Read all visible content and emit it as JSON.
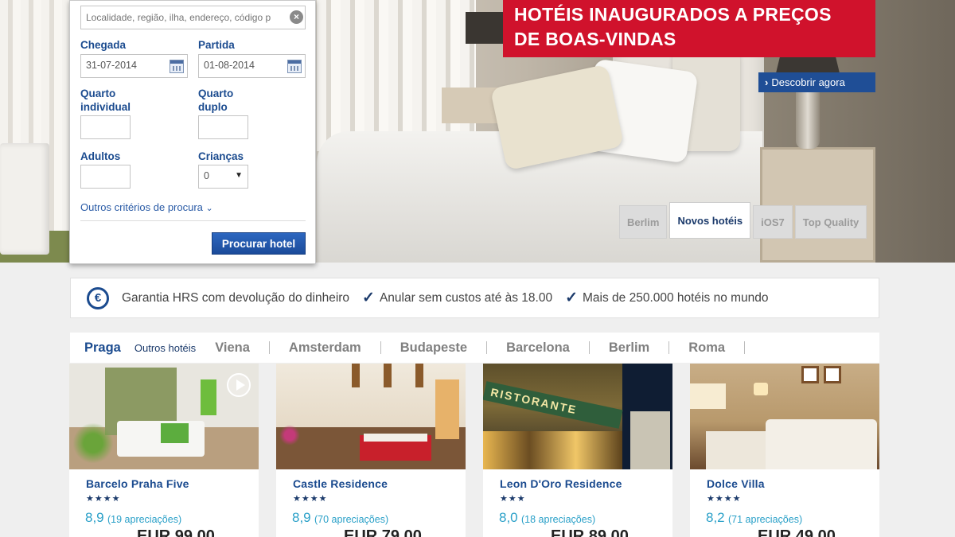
{
  "search": {
    "location_placeholder": "Localidade, região, ilha, endereço, código p",
    "checkin_label": "Chegada",
    "checkin_value": "31-07-2014",
    "checkout_label": "Partida",
    "checkout_value": "01-08-2014",
    "single_room_label_1": "Quarto",
    "single_room_label_2": "individual",
    "double_room_label_1": "Quarto",
    "double_room_label_2": "duplo",
    "adults_label": "Adultos",
    "children_label": "Crianças",
    "children_value": "0",
    "more_criteria": "Outros critérios de procura",
    "submit": "Procurar hotel"
  },
  "hero": {
    "promo_line1": "HOTÉIS INAUGURADOS A PREÇOS",
    "promo_line2": "DE BOAS-VINDAS",
    "discover": "Descobrir agora",
    "tabs": [
      "Berlim",
      "Novos hotéis",
      "iOS7",
      "Top Quality"
    ],
    "active_tab": 1
  },
  "guarantee": {
    "money_back": "Garantia HRS com devolução do dinheiro",
    "free_cancel": "Anular sem custos até às 18.00",
    "hotels_count": "Mais de 250.000 hotéis no mundo"
  },
  "cities": {
    "active": "Praga",
    "other_hotels": "Outros hotéis",
    "list": [
      "Viena",
      "Amsterdam",
      "Budapeste",
      "Barcelona",
      "Berlim",
      "Roma"
    ]
  },
  "hotels": [
    {
      "name": "Barcelo Praha Five",
      "stars": "★★★★",
      "rating": "8,9",
      "reviews": "(19 apreciações)",
      "price": "EUR 99,00"
    },
    {
      "name": "Castle Residence",
      "stars": "★★★★",
      "rating": "8,9",
      "reviews": "(70 apreciações)",
      "price": "EUR 79,00"
    },
    {
      "name": "Leon D'Oro Residence",
      "stars": "★★★",
      "rating": "8,0",
      "reviews": "(18 apreciações)",
      "price": "EUR 89,00"
    },
    {
      "name": "Dolce Villa",
      "stars": "★★★★",
      "rating": "8,2",
      "reviews": "(71 apreciações)",
      "price": "EUR 49,00"
    }
  ],
  "colors": {
    "promo_red": "#d0122c",
    "brand_blue": "#1b4b8f",
    "rating_teal": "#2aa0c8"
  },
  "icons": [
    "clear-icon",
    "calendar-icon",
    "chevron-down-icon",
    "chevron-right-icon",
    "euro-icon",
    "check-icon",
    "play-icon"
  ]
}
